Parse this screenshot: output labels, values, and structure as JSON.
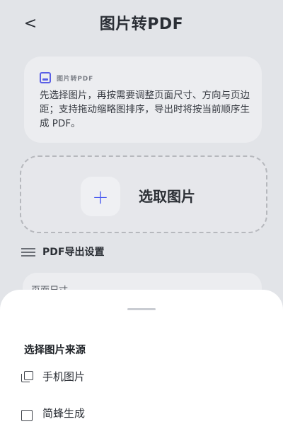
{
  "appbar": {
    "title": "图片转PDF",
    "back_icon": "chevron-left-icon"
  },
  "info": {
    "title": "图片转PDF",
    "text": "先选择图片，再按需要调整页面尺寸、方向与页边距；支持拖动缩略图排序，导出时将按当前顺序生成 PDF。"
  },
  "picker": {
    "label": "选取图片",
    "icon": "plus-icon"
  },
  "settings": {
    "title": "PDF导出设置",
    "first_row_label": "页面尺寸",
    "icon": "tune-icon"
  },
  "sheet": {
    "title": "选择图片来源",
    "items": [
      {
        "label": "手机图片",
        "icon": "photo-library-icon"
      },
      {
        "label": "简蜂生成",
        "icon": "image-generate-icon"
      }
    ]
  },
  "colors": {
    "accent": "#4a5cf0"
  }
}
